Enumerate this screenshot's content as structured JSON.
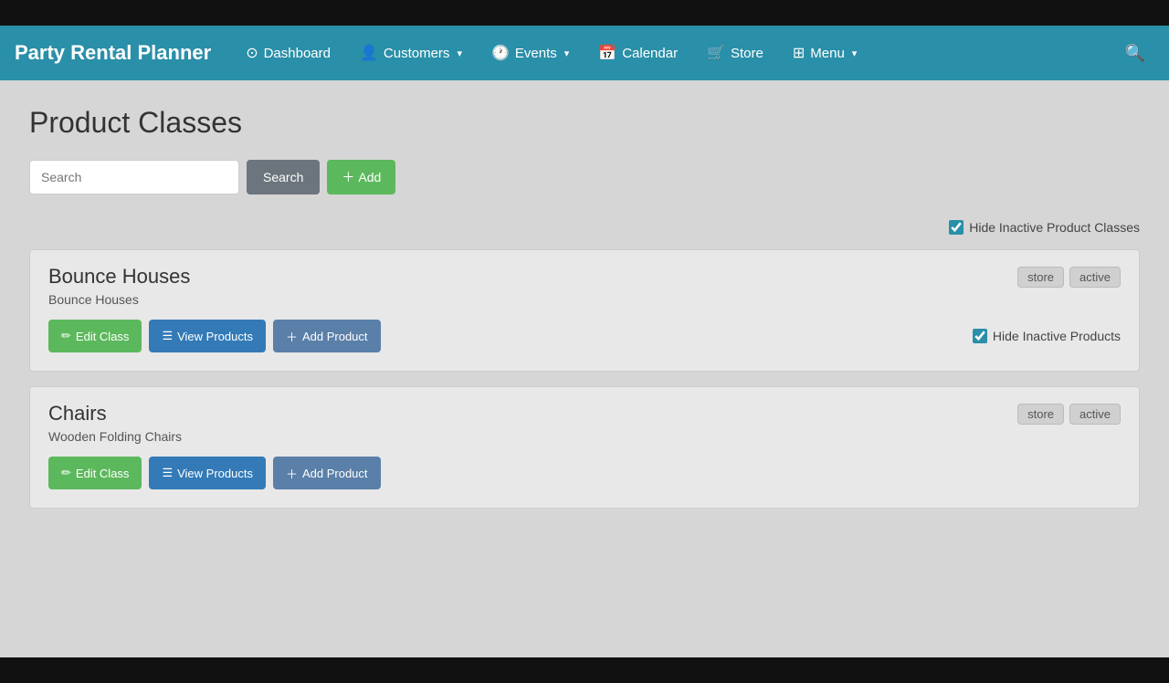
{
  "topBar": {},
  "navbar": {
    "brand": "Party Rental Planner",
    "items": [
      {
        "id": "dashboard",
        "label": "Dashboard",
        "icon": "⊙",
        "hasDropdown": false
      },
      {
        "id": "customers",
        "label": "Customers",
        "icon": "👤",
        "hasDropdown": true
      },
      {
        "id": "events",
        "label": "Events",
        "icon": "🕐",
        "hasDropdown": true
      },
      {
        "id": "calendar",
        "label": "Calendar",
        "icon": "📅",
        "hasDropdown": false
      },
      {
        "id": "store",
        "label": "Store",
        "icon": "🛒",
        "hasDropdown": false
      },
      {
        "id": "menu",
        "label": "Menu",
        "icon": "⊞",
        "hasDropdown": true
      }
    ],
    "searchIcon": "🔍"
  },
  "page": {
    "title": "Product Classes",
    "search": {
      "placeholder": "Search",
      "searchLabel": "Search",
      "addLabel": "+ Add"
    },
    "hideInactiveClasses": {
      "label": "Hide Inactive Product Classes",
      "checked": true
    },
    "classes": [
      {
        "id": "bounce-houses",
        "name": "Bounce Houses",
        "description": "Bounce Houses",
        "badges": [
          "store",
          "active"
        ],
        "buttons": {
          "edit": "Edit Class",
          "viewProducts": "View Products",
          "addProduct": "Add Product"
        },
        "hideInactiveProducts": {
          "label": "Hide Inactive Products",
          "checked": true
        }
      },
      {
        "id": "chairs",
        "name": "Chairs",
        "description": "Wooden Folding Chairs",
        "badges": [
          "store",
          "active"
        ],
        "buttons": {
          "edit": "Edit Class",
          "viewProducts": "View Products",
          "addProduct": "Add Product"
        },
        "hideInactiveProducts": null
      }
    ]
  }
}
